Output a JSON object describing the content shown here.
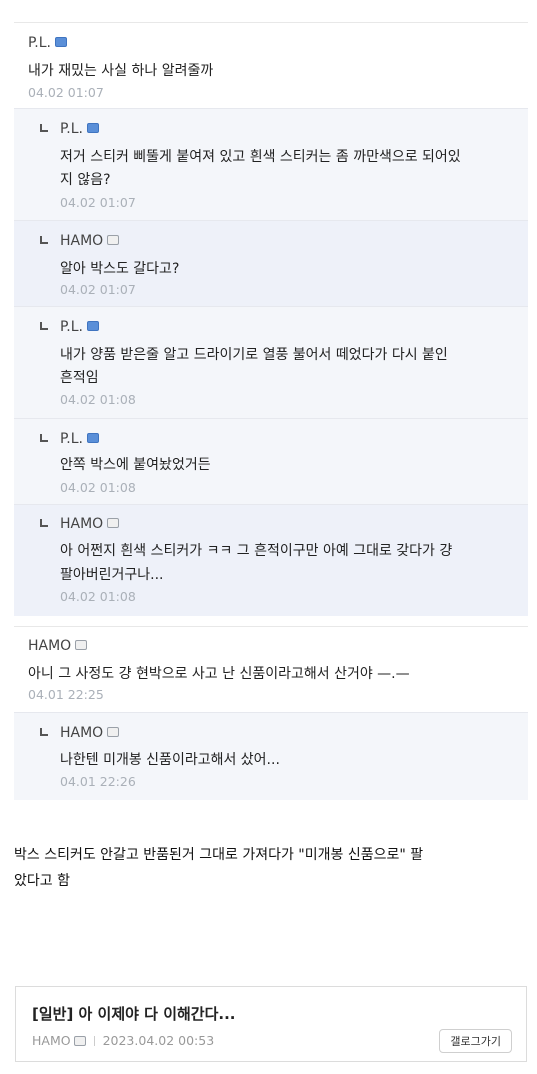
{
  "comments": [
    {
      "author": "P.L.",
      "badge": "blue",
      "text": "내가 재밌는 사실 하나 알려줄까",
      "time": "04.02 01:07",
      "reply": false
    },
    {
      "author": "P.L.",
      "badge": "blue",
      "text": "저거 스티커 삐뚤게 붙여져 있고 흰색 스티커는 좀 까만색으로 되어있지 않음?",
      "line1": "저거 스티커 삐뚤게 붙여져 있고 흰색 스티커는 좀 까만색으로 되어있",
      "line2": "지 않음?",
      "time": "04.02 01:07",
      "reply": true
    },
    {
      "author": "HAMO",
      "badge": "gray",
      "text": "알아 박스도 갈다고?",
      "time": "04.02 01:07",
      "reply": true
    },
    {
      "author": "P.L.",
      "badge": "blue",
      "text": "내가 양품 받은줄 알고 드라이기로 열풍 불어서 떼었다가 다시 붙인 흔적임",
      "line1": "내가 양품 받은줄 알고 드라이기로 열풍 불어서 떼었다가 다시 붙인",
      "line2": "흔적임",
      "time": "04.02 01:08",
      "reply": true
    },
    {
      "author": "P.L.",
      "badge": "blue",
      "text": "안쪽 박스에 붙여놨었거든",
      "time": "04.02 01:08",
      "reply": true
    },
    {
      "author": "HAMO",
      "badge": "gray",
      "text": "아 어쩐지 흰색 스티커가 ㅋㅋ 그 흔적이구만 아예 그대로 갖다가 걍 팔아버린거구나...",
      "line1": "아 어쩐지 흰색 스티커가 ㅋㅋ 그 흔적이구만 아예 그대로 갖다가 걍",
      "line2": "팔아버린거구나...",
      "time": "04.02 01:08",
      "reply": true
    },
    {
      "author": "HAMO",
      "badge": "gray",
      "text": "아니 그 사정도 걍 현박으로 사고 난 신품이라고해서 산거야 —.—",
      "time": "04.01 22:25",
      "reply": false
    },
    {
      "author": "HAMO",
      "badge": "gray",
      "text": "나한텐 미개봉 신품이라고해서 샀어...",
      "time": "04.01 22:26",
      "reply": true
    }
  ],
  "body": {
    "line1": "박스 스티커도 안갈고 반품된거 그대로 가져다가 \"미개봉 신품으로\" 팔",
    "line2": "았다고 함"
  },
  "post_card": {
    "title": "[일반] 아 이제야 다 이해간다...",
    "author": "HAMO",
    "date": "2023.04.02 00:53",
    "gallery_button": "갤로그가기"
  }
}
